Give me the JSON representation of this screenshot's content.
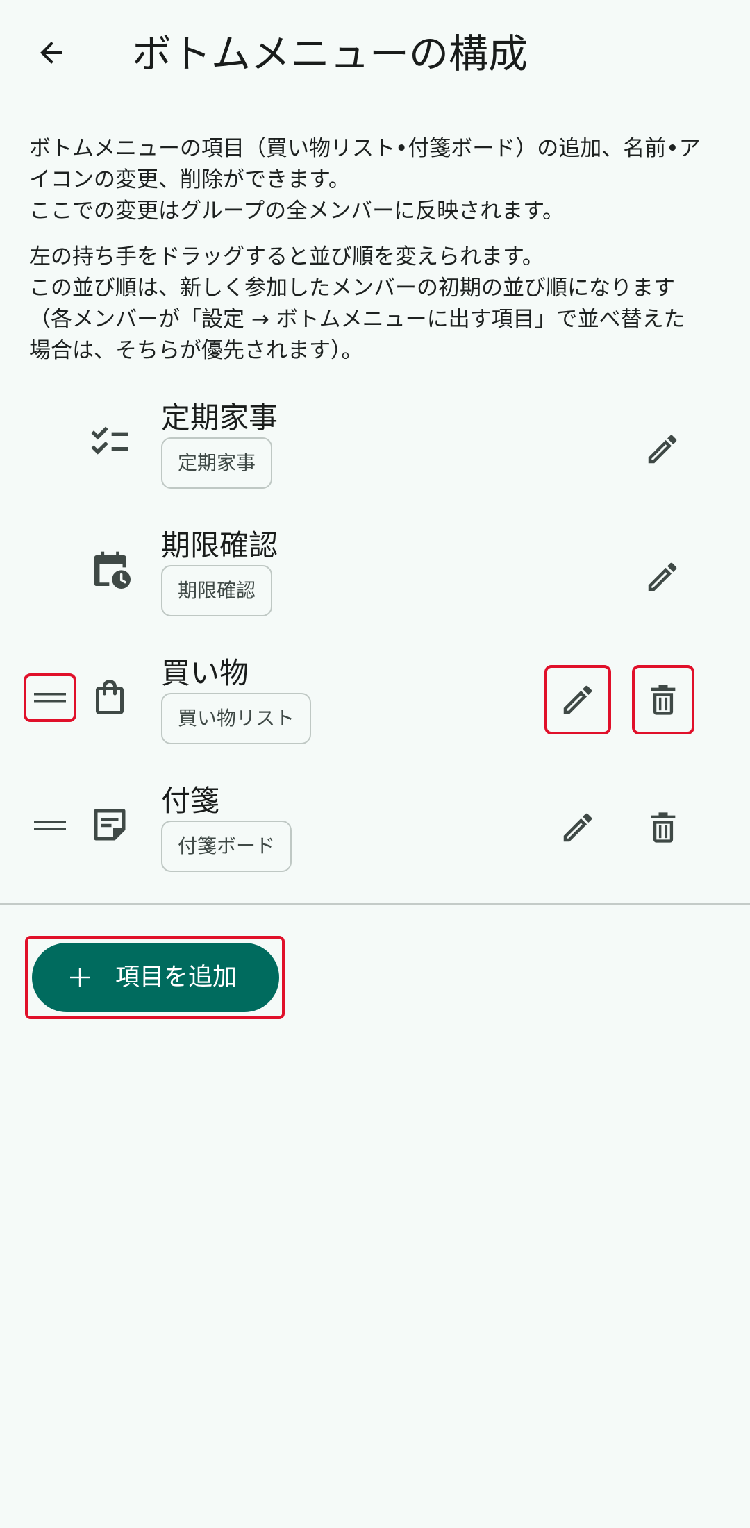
{
  "header": {
    "title": "ボトムメニューの構成",
    "back_icon": "arrow-left-icon"
  },
  "description": {
    "paragraph1": [
      "ボトムメニューの項目（買い物リスト•付箋ボード）の追加、名前•ア",
      "イコンの変更、削除ができます。",
      "ここでの変更はグループの全メンバーに反映されます。"
    ],
    "paragraph2": [
      "左の持ち手をドラッグすると並び順を変えられます。",
      "この並び順は、新しく参加したメンバーの初期の並び順になります",
      "（各メンバーが「設定 → ボトムメニューに出す項目」で並べ替えた",
      "場合は、そちらが優先されます）。"
    ]
  },
  "items": [
    {
      "name": "定期家事",
      "chip": "定期家事",
      "icon": "checklist-icon",
      "draggable": false,
      "deletable": false
    },
    {
      "name": "期限確認",
      "chip": "期限確認",
      "icon": "calendar-clock-icon",
      "draggable": false,
      "deletable": false
    },
    {
      "name": "買い物",
      "chip": "買い物リスト",
      "icon": "shopping-bag-icon",
      "draggable": true,
      "deletable": true
    },
    {
      "name": "付箋",
      "chip": "付箋ボード",
      "icon": "sticky-note-icon",
      "draggable": true,
      "deletable": true
    }
  ],
  "add_button": {
    "label": "項目を追加",
    "icon": "plus-icon"
  },
  "colors": {
    "background": "#f5faf8",
    "primary": "#006b5e",
    "highlight": "#e0102a",
    "icon": "#3f4946",
    "chip_border": "#bfc8c4"
  }
}
